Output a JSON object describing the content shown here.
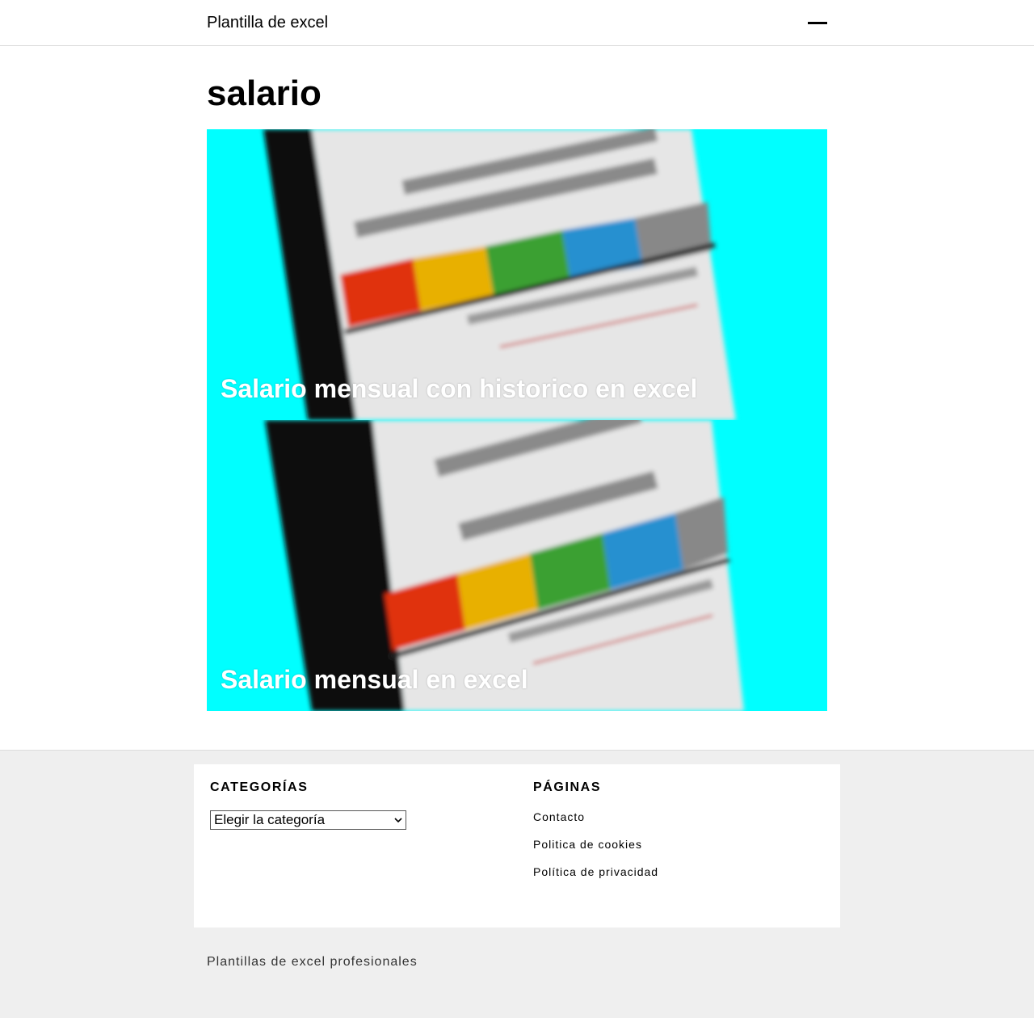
{
  "header": {
    "site_title": "Plantilla de excel"
  },
  "archive": {
    "title": "salario"
  },
  "posts": [
    {
      "title": "Salario mensual con historico en excel"
    },
    {
      "title": "Salario mensual en excel"
    }
  ],
  "footer": {
    "categories": {
      "title": "CATEGORÍAS",
      "select_value": "Elegir la categoría"
    },
    "pages": {
      "title": "PÁGINAS",
      "links": [
        "Contacto",
        "Politica de cookies",
        "Política de privacidad"
      ]
    },
    "site_info": "Plantillas de excel profesionales"
  },
  "colors": {
    "accent": "#00ffff",
    "footer_bg": "#efefef"
  }
}
